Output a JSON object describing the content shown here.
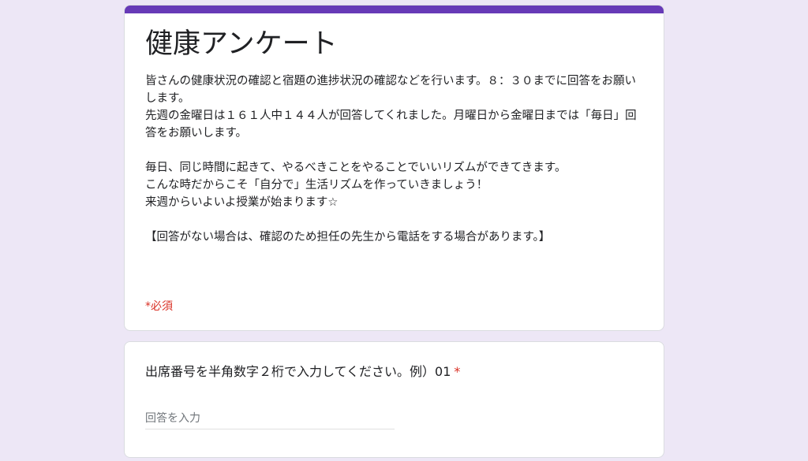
{
  "colors": {
    "page_background": "#ede7f6",
    "accent": "#673ab7",
    "required": "#d93025"
  },
  "form": {
    "title": "健康アンケート",
    "description": [
      "皆さんの健康状況の確認と宿題の進捗状況の確認などを行います。８：３０までに回答をお願いします。",
      "先週の金曜日は１６１人中１４４人が回答してくれました。月曜日から金曜日までは「毎日」回答をお願いします。",
      "",
      "毎日、同じ時間に起きて、やるべきことをやることでいいリズムができてきます。",
      "こんな時だからこそ「自分で」生活リズムを作っていきましょう！",
      "来週からいよいよ授業が始まります☆",
      "",
      "【回答がない場合は、確認のため担任の先生から電話をする場合があります。】"
    ],
    "required_note": "*必須"
  },
  "question1": {
    "label": "出席番号を半角数字２桁で入力してください。例）01",
    "required_mark": "*",
    "placeholder": "回答を入力",
    "value": ""
  }
}
